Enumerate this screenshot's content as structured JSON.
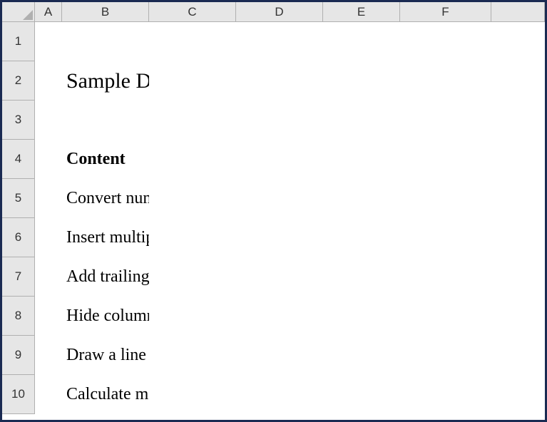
{
  "columns": [
    "A",
    "B",
    "C",
    "D",
    "E",
    "F",
    ""
  ],
  "rows": [
    "1",
    "2",
    "3",
    "4",
    "5",
    "6",
    "7",
    "8",
    "9",
    "10"
  ],
  "cells": {
    "B2": "Sample Data Set",
    "B4": "Content",
    "B5": "Convert number to words in excel in rupees",
    "B6": "Insert multiple page breaks in excel",
    "B7": "Add trailing zeros in excel",
    "B8": "Hide columns in excel with password",
    "B9": "Draw a line through text in excel",
    "B10": "Calculate monthly mortgage payment in excel"
  }
}
